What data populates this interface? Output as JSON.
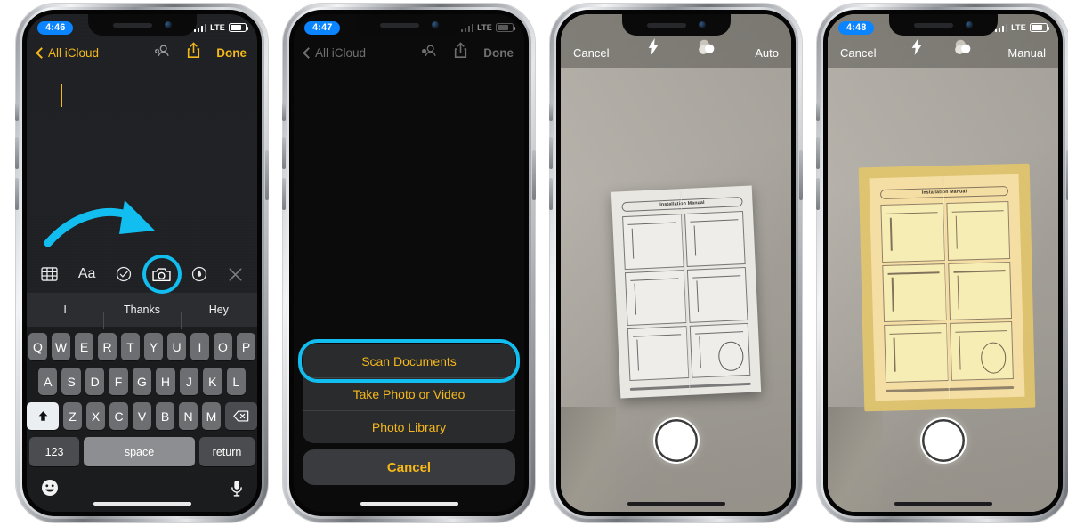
{
  "phones": [
    {
      "id": "notes-editor",
      "status": {
        "time": "4:46",
        "carrier_tech": "LTE",
        "time_style": "pill"
      },
      "navbar": {
        "back_label": "All iCloud",
        "done_label": "Done",
        "person_icon": "add-person-icon",
        "share_icon": "share-icon"
      },
      "toolbar": {
        "items": [
          {
            "icon": "table-icon",
            "label": ""
          },
          {
            "icon": "text-format-icon",
            "label": "Aa"
          },
          {
            "icon": "checklist-icon",
            "label": ""
          },
          {
            "icon": "camera-icon",
            "label": "",
            "highlighted": true
          },
          {
            "icon": "markup-pen-icon",
            "label": ""
          },
          {
            "icon": "close-icon",
            "label": ""
          }
        ]
      },
      "suggestions": [
        "I",
        "Thanks",
        "Hey"
      ],
      "keyboard": {
        "row1": [
          "Q",
          "W",
          "E",
          "R",
          "T",
          "Y",
          "U",
          "I",
          "O",
          "P"
        ],
        "row2": [
          "A",
          "S",
          "D",
          "F",
          "G",
          "H",
          "J",
          "K",
          "L"
        ],
        "row3": [
          "Z",
          "X",
          "C",
          "V",
          "B",
          "N",
          "M"
        ],
        "shift_icon": "shift-up-icon",
        "delete_icon": "backspace-icon",
        "numbers_label": "123",
        "space_label": "space",
        "return_label": "return",
        "emoji_icon": "emoji-smiley-icon",
        "dictation_icon": "microphone-icon"
      },
      "annotation": {
        "type": "curved-arrow",
        "color": "#12bdf0",
        "points_to": "camera-icon"
      }
    },
    {
      "id": "notes-action-sheet",
      "status": {
        "time": "4:47",
        "carrier_tech": "LTE",
        "time_style": "pill"
      },
      "navbar": {
        "back_label": "All iCloud",
        "done_label": "Done",
        "person_icon": "add-person-icon",
        "share_icon": "share-icon"
      },
      "action_sheet": {
        "options": [
          "Scan Documents",
          "Take Photo or Video",
          "Photo Library"
        ],
        "highlighted_option": "Scan Documents",
        "cancel_label": "Cancel"
      }
    },
    {
      "id": "document-scanner-auto",
      "status": {
        "time": "",
        "carrier_tech": "",
        "time_style": "none"
      },
      "camera_bar": {
        "cancel_label": "Cancel",
        "flash_icon": "flash-bolt-icon",
        "filter_icon": "color-filters-icon",
        "mode_label": "Auto"
      },
      "shutter": "shutter-button",
      "subject": {
        "doc_title": "Installation  Manual",
        "detected": false
      }
    },
    {
      "id": "document-scanner-manual",
      "status": {
        "time": "4:48",
        "carrier_tech": "LTE",
        "time_style": "pill"
      },
      "camera_bar": {
        "cancel_label": "Cancel",
        "flash_icon": "flash-bolt-icon",
        "filter_icon": "color-filters-icon",
        "mode_label": "Manual"
      },
      "shutter": "shutter-button",
      "subject": {
        "doc_title": "Installation  Manual",
        "detected": true,
        "detection_color": "#e2c66c"
      }
    }
  ],
  "colors": {
    "highlight": "#12bdf0",
    "accent_yellow": "#f5b81a",
    "status_pill_blue": "#0a84ff",
    "notes_bg": "#1f2124",
    "dimmed_bg": "#0b0b0c"
  }
}
